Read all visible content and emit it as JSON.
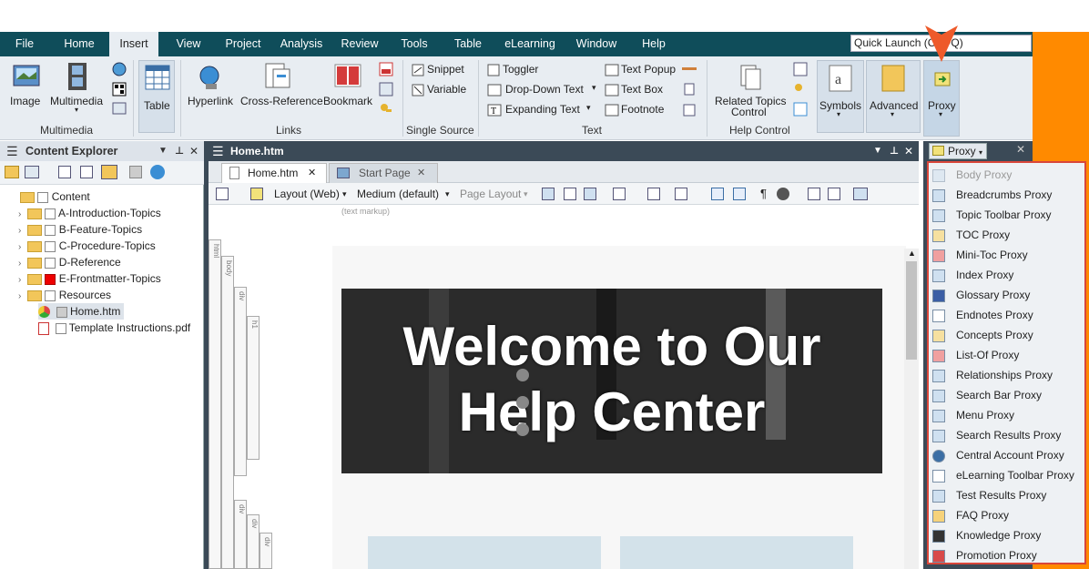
{
  "menu": {
    "items": [
      "File",
      "Home",
      "Insert",
      "View",
      "Project",
      "Analysis",
      "Review",
      "Tools",
      "Table",
      "eLearning",
      "Window",
      "Help"
    ],
    "quick_launch": "Quick Launch (Ctrl+Q)"
  },
  "ribbon": {
    "image": "Image",
    "multimedia": "Multimedia",
    "table": "Table",
    "hyperlink": "Hyperlink",
    "cross_reference": "Cross-Reference",
    "bookmark": "Bookmark",
    "snippet": "Snippet",
    "variable": "Variable",
    "toggler": "Toggler",
    "dropdown_text": "Drop-Down Text",
    "expanding_text": "Expanding Text",
    "text_popup": "Text Popup",
    "text_box": "Text Box",
    "footnote": "Footnote",
    "related_topics": "Related Topics",
    "control": "Control",
    "symbols": "Symbols",
    "advanced": "Advanced",
    "proxy": "Proxy",
    "groups": {
      "multimedia": "Multimedia",
      "links": "Links",
      "single_source": "Single Source",
      "text": "Text",
      "help_control": "Help Control"
    }
  },
  "content_explorer": {
    "title": "Content Explorer",
    "tree": [
      {
        "label": "Content",
        "type": "root"
      },
      {
        "label": "A-Introduction-Topics",
        "type": "folder"
      },
      {
        "label": "B-Feature-Topics",
        "type": "folder"
      },
      {
        "label": "C-Procedure-Topics",
        "type": "folder"
      },
      {
        "label": "D-Reference",
        "type": "folder"
      },
      {
        "label": "E-Frontmatter-Topics",
        "type": "folder"
      },
      {
        "label": "Resources",
        "type": "folder"
      },
      {
        "label": "Home.htm",
        "type": "file"
      },
      {
        "label": "Template Instructions.pdf",
        "type": "pdf"
      }
    ]
  },
  "editor": {
    "title": "Home.htm",
    "tabs": [
      "Home.htm",
      "Start Page"
    ],
    "layout": "Layout (Web)",
    "medium": "Medium (default)",
    "page_layout": "Page Layout",
    "markup": "(text markup)",
    "struct_tags": [
      "html",
      "body",
      "div",
      "h1",
      "div",
      "div",
      "div"
    ],
    "hero_text": "Welcome to Our Help Center"
  },
  "proxy_panel": {
    "button": "Proxy",
    "items": [
      "Body Proxy",
      "Breadcrumbs Proxy",
      "Topic Toolbar Proxy",
      "TOC Proxy",
      "Mini-Toc Proxy",
      "Index Proxy",
      "Glossary Proxy",
      "Endnotes Proxy",
      "Concepts Proxy",
      "List-Of Proxy",
      "Relationships Proxy",
      "Search Bar Proxy",
      "Menu Proxy",
      "Search Results Proxy",
      "Central Account Proxy",
      "eLearning Toolbar Proxy",
      "Test Results Proxy",
      "FAQ Proxy",
      "Knowledge Proxy",
      "Promotion Proxy"
    ]
  },
  "colors": {
    "menubar": "#0f4d5a",
    "accent": "#ff8a00",
    "highlight": "#d9463a"
  }
}
